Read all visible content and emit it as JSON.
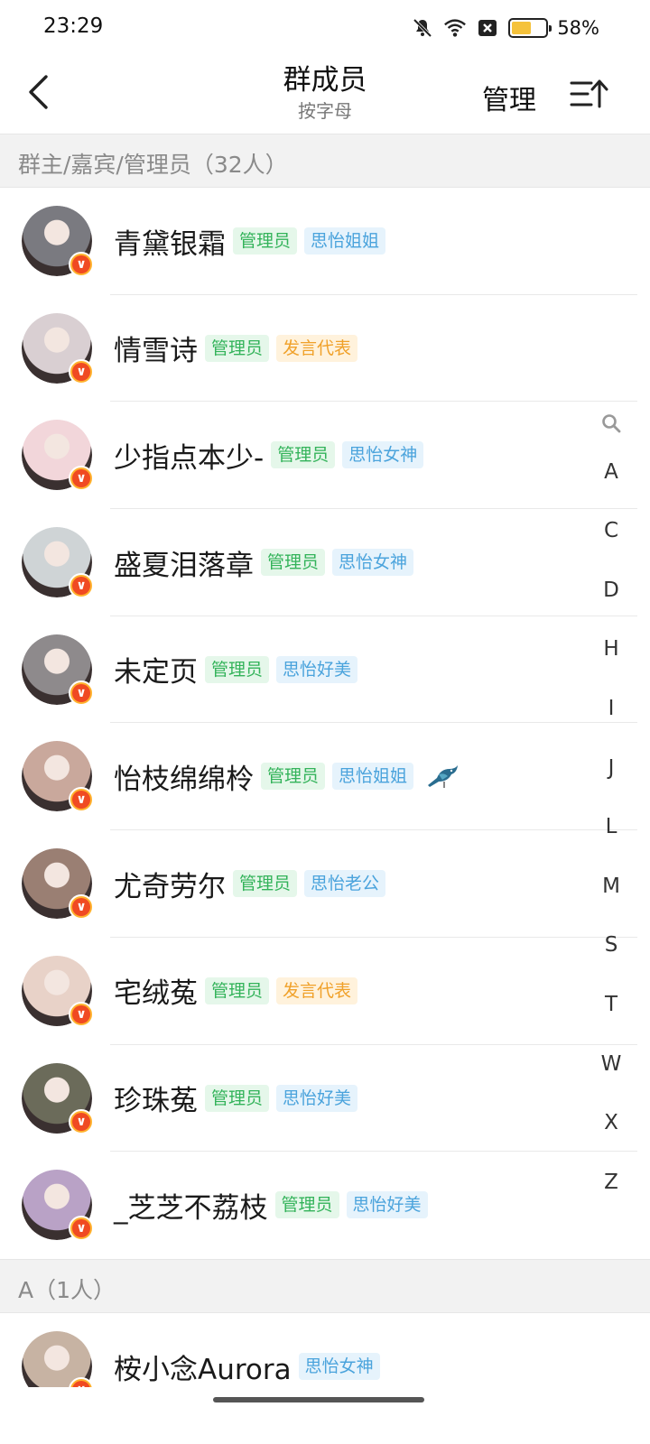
{
  "status_bar": {
    "time": "23:29",
    "battery_text": "58%",
    "battery_level": 0.58,
    "icons": [
      "bell-off-icon",
      "wifi-icon",
      "sim-off-icon",
      "battery-icon"
    ]
  },
  "header": {
    "title": "群成员",
    "subtitle": "按字母",
    "manage_label": "管理",
    "back_icon": "back-arrow-icon",
    "sort_icon": "sort-ascending-icon"
  },
  "sections": [
    {
      "label": "群主/嘉宾/管理员（32人）",
      "members": [
        {
          "name": "青黛银霜",
          "tags": [
            {
              "text": "管理员",
              "kind": "admin"
            },
            {
              "text": "思怡姐姐",
              "kind": "blue"
            }
          ]
        },
        {
          "name": "情雪诗",
          "tags": [
            {
              "text": "管理员",
              "kind": "admin"
            },
            {
              "text": "发言代表",
              "kind": "orange"
            }
          ]
        },
        {
          "name": "少指点本少-",
          "tags": [
            {
              "text": "管理员",
              "kind": "admin"
            },
            {
              "text": "思怡女神",
              "kind": "blue"
            }
          ]
        },
        {
          "name": "盛夏泪落章",
          "tags": [
            {
              "text": "管理员",
              "kind": "admin"
            },
            {
              "text": "思怡女神",
              "kind": "blue"
            }
          ]
        },
        {
          "name": "未定页",
          "tags": [
            {
              "text": "管理员",
              "kind": "admin"
            },
            {
              "text": "思怡好美",
              "kind": "blue"
            }
          ]
        },
        {
          "name": "怡枝绵绵柃",
          "tags": [
            {
              "text": "管理员",
              "kind": "admin"
            },
            {
              "text": "思怡姐姐",
              "kind": "blue"
            }
          ],
          "badge_icon": "bird-icon"
        },
        {
          "name": "尤奇劳尔",
          "tags": [
            {
              "text": "管理员",
              "kind": "admin"
            },
            {
              "text": "思怡老公",
              "kind": "blue"
            }
          ]
        },
        {
          "name": "宅绒菟",
          "tags": [
            {
              "text": "管理员",
              "kind": "admin"
            },
            {
              "text": "发言代表",
              "kind": "orange"
            }
          ]
        },
        {
          "name": "珍珠菟",
          "tags": [
            {
              "text": "管理员",
              "kind": "admin"
            },
            {
              "text": "思怡好美",
              "kind": "blue"
            }
          ]
        },
        {
          "name": "_芝芝不荔枝",
          "tags": [
            {
              "text": "管理员",
              "kind": "admin"
            },
            {
              "text": "思怡好美",
              "kind": "blue"
            }
          ]
        }
      ]
    },
    {
      "label": "A（1人）",
      "members": [
        {
          "name": "桉小念Aurora",
          "tags": [
            {
              "text": "思怡女神",
              "kind": "blue"
            }
          ]
        }
      ]
    }
  ],
  "alpha_index": {
    "search_icon": "search-icon",
    "letters": [
      "A",
      "C",
      "D",
      "H",
      "I",
      "J",
      "L",
      "M",
      "S",
      "T",
      "W",
      "X",
      "Z"
    ]
  },
  "avatar_colors": [
    "#7a7a80",
    "#d9cfd2",
    "#f2d6da",
    "#cfd4d6",
    "#8e8a8c",
    "#c9a89c",
    "#9a7f73",
    "#e8d2c8",
    "#6b6b5a",
    "#b9a2c6",
    "#c7b3a3"
  ],
  "colors": {
    "admin_tag": "#33b35a",
    "blue_tag": "#4aa3dc",
    "orange_tag": "#f0a12a",
    "section_bg": "#f2f2f2",
    "vip_badge": "#f04a22"
  }
}
